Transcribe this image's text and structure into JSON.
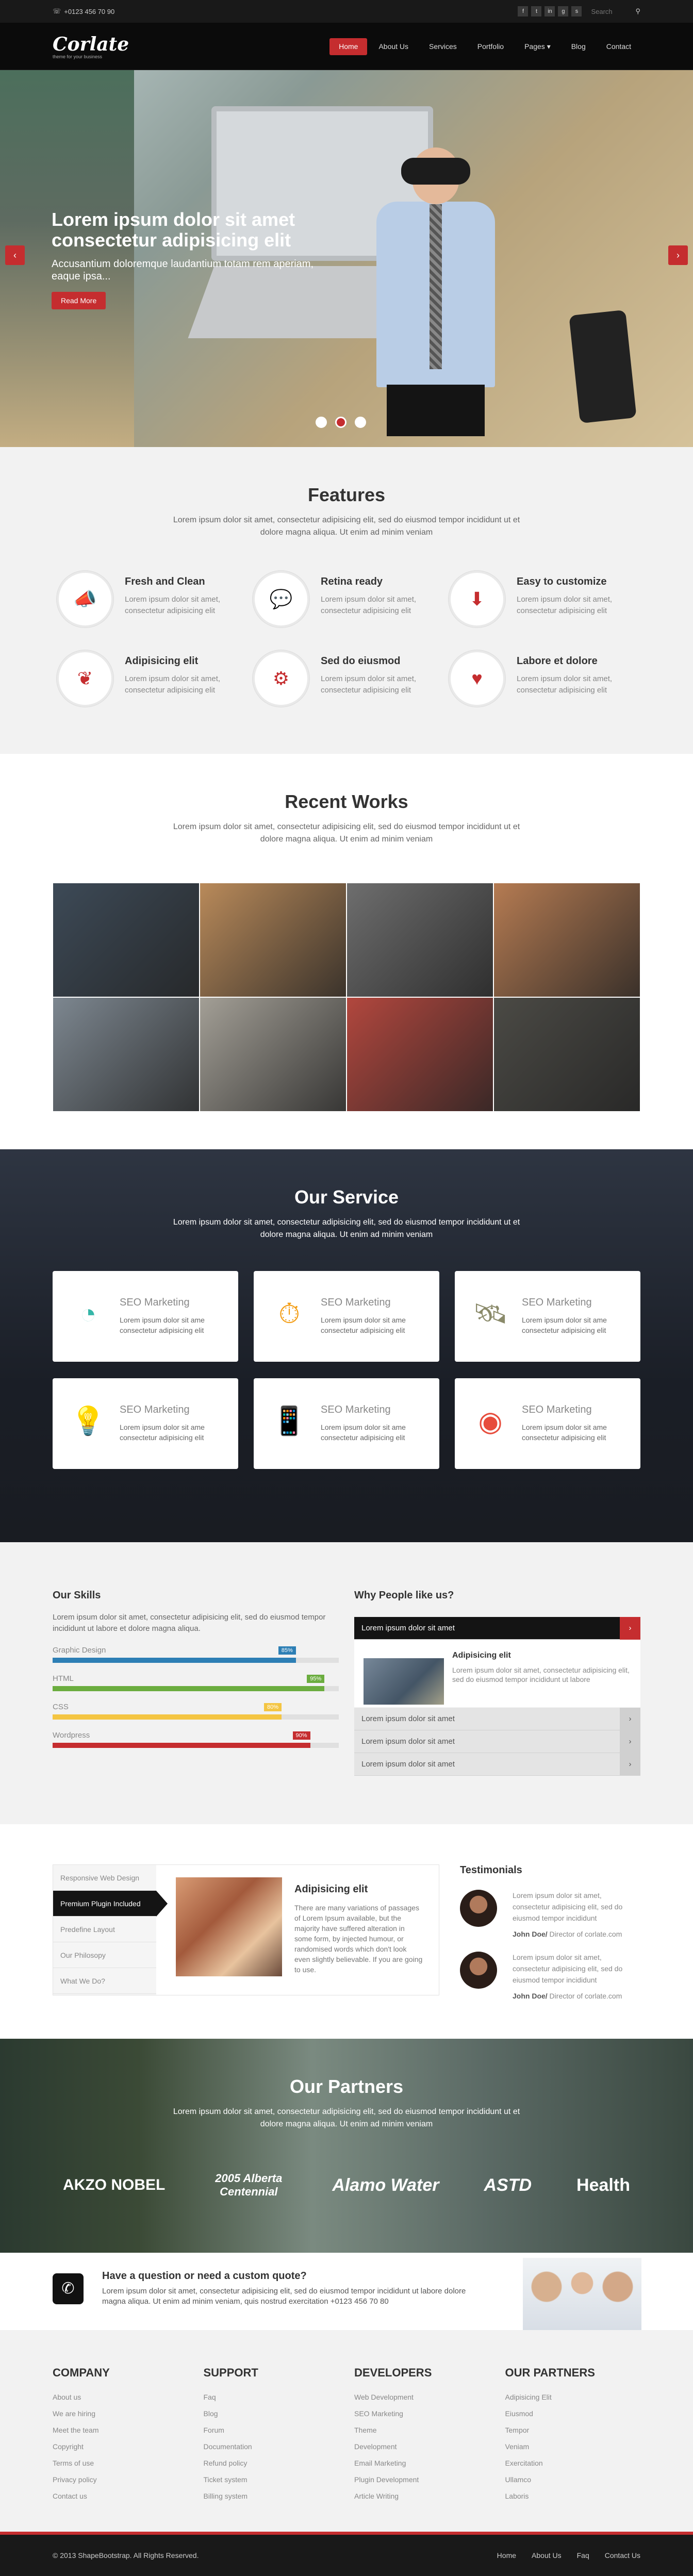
{
  "topbar": {
    "phone": "+0123 456 70 90",
    "search_placeholder": "Search",
    "social": [
      "f",
      "t",
      "in",
      "g",
      "s"
    ]
  },
  "nav": {
    "logo": "Corlate",
    "tagline": "theme for your business",
    "items": [
      "Home",
      "About Us",
      "Services",
      "Portfolio",
      "Pages",
      "Blog",
      "Contact"
    ],
    "active": "Home",
    "dropdown": "Pages"
  },
  "hero": {
    "title": "Lorem ipsum dolor sit amet consectetur adipisicing elit",
    "subtitle": "Accusantium doloremque laudantium totam rem aperiam, eaque ipsa...",
    "button": "Read More",
    "prev": "‹",
    "next": "›",
    "slides": 3,
    "active_slide": 2
  },
  "features": {
    "title": "Features",
    "lead": "Lorem ipsum dolor sit amet, consectetur adipisicing elit, sed do eiusmod tempor incididunt ut et dolore magna aliqua. Ut enim ad minim veniam",
    "items": [
      {
        "icon": "bullhorn-icon",
        "glyph": "📣",
        "title": "Fresh and Clean",
        "text": "Lorem ipsum dolor sit amet, consectetur adipisicing elit"
      },
      {
        "icon": "comments-icon",
        "glyph": "💬",
        "title": "Retina ready",
        "text": "Lorem ipsum dolor sit amet, consectetur adipisicing elit"
      },
      {
        "icon": "download-icon",
        "glyph": "⬇",
        "title": "Easy to customize",
        "text": "Lorem ipsum dolor sit amet, consectetur adipisicing elit"
      },
      {
        "icon": "leaf-icon",
        "glyph": "❦",
        "title": "Adipisicing elit",
        "text": "Lorem ipsum dolor sit amet, consectetur adipisicing elit"
      },
      {
        "icon": "cogs-icon",
        "glyph": "⚙",
        "title": "Sed do eiusmod",
        "text": "Lorem ipsum dolor sit amet, consectetur adipisicing elit"
      },
      {
        "icon": "heart-icon",
        "glyph": "♥",
        "title": "Labore et dolore",
        "text": "Lorem ipsum dolor sit amet, consectetur adipisicing elit"
      }
    ]
  },
  "works": {
    "title": "Recent Works",
    "lead": "Lorem ipsum dolor sit amet, consectetur adipisicing elit, sed do eiusmod tempor incididunt ut et dolore magna aliqua. Ut enim ad minim veniam",
    "tiles": [
      "#3d4a57",
      "#b98a5a",
      "#6e6e6e",
      "#b57b52",
      "#7d8790",
      "#a39f96",
      "#b2473e",
      "#4b4a45"
    ]
  },
  "services": {
    "title": "Our Service",
    "lead": "Lorem ipsum dolor sit amet, consectetur adipisicing elit, sed do eiusmod tempor incididunt ut et dolore magna aliqua. Ut enim ad minim veniam",
    "items": [
      {
        "icon": "pie-chart-icon",
        "glyph": "◔",
        "color": "#35b6a8",
        "title": "SEO Marketing",
        "text": "Lorem ipsum dolor sit ame consectetur adipisicing elit"
      },
      {
        "icon": "stopwatch-icon",
        "glyph": "⏱",
        "color": "#f39c12",
        "title": "SEO Marketing",
        "text": "Lorem ipsum dolor sit ame consectetur adipisicing elit"
      },
      {
        "icon": "satellite-icon",
        "glyph": "🛰",
        "color": "#8a8a6a",
        "title": "SEO Marketing",
        "text": "Lorem ipsum dolor sit ame consectetur adipisicing elit"
      },
      {
        "icon": "lightbulb-icon",
        "glyph": "💡",
        "color": "#f2c94c",
        "title": "SEO Marketing",
        "text": "Lorem ipsum dolor sit ame consectetur adipisicing elit"
      },
      {
        "icon": "tablet-icon",
        "glyph": "📱",
        "color": "#3b7fc4",
        "title": "SEO Marketing",
        "text": "Lorem ipsum dolor sit ame consectetur adipisicing elit"
      },
      {
        "icon": "lifebuoy-icon",
        "glyph": "◉",
        "color": "#e74c3c",
        "title": "SEO Marketing",
        "text": "Lorem ipsum dolor sit ame consectetur adipisicing elit"
      }
    ]
  },
  "skills": {
    "title": "Our Skills",
    "text": "Lorem ipsum dolor sit amet, consectetur adipisicing elit, sed do eiusmod tempor incididunt ut labore et dolore magna aliqua.",
    "items": [
      {
        "name": "Graphic Design",
        "percent": 85,
        "label": "85%",
        "color": "#2d7fb5"
      },
      {
        "name": "HTML",
        "percent": 95,
        "label": "95%",
        "color": "#6bad3f"
      },
      {
        "name": "CSS",
        "percent": 80,
        "label": "80%",
        "color": "#f4c542"
      },
      {
        "name": "Wordpress",
        "percent": 90,
        "label": "90%",
        "color": "#c52d2f"
      }
    ]
  },
  "why": {
    "title": "Why People like us?",
    "open_item": "Lorem ipsum dolor sit amet",
    "open_title": "Adipisicing elit",
    "open_text": "Lorem ipsum dolor sit amet, consectetur adipisicing elit, sed do eiusmod tempor incididunt ut labore",
    "items": [
      "Lorem ipsum dolor sit amet",
      "Lorem ipsum dolor sit amet",
      "Lorem ipsum dolor sit amet"
    ]
  },
  "tabs": {
    "items": [
      "Responsive Web Design",
      "Premium Plugin Included",
      "Predefine Layout",
      "Our Philosopy",
      "What We Do?"
    ],
    "active": 1,
    "title": "Adipisicing elit",
    "text": "There are many variations of passages of Lorem Ipsum available, but the majority have suffered alteration in some form, by injected humour, or randomised words which don't look even slightly believable. If you are going to use."
  },
  "testimonials": {
    "title": "Testimonials",
    "items": [
      {
        "text": "Lorem ipsum dolor sit amet, consectetur adipisicing elit, sed do eiusmod tempor incididunt",
        "name": "John Doe/",
        "role": " Director of corlate.com"
      },
      {
        "text": "Lorem ipsum dolor sit amet, consectetur adipisicing elit, sed do eiusmod tempor incididunt",
        "name": "John Doe/",
        "role": " Director of corlate.com"
      }
    ]
  },
  "partners": {
    "title": "Our Partners",
    "lead": "Lorem ipsum dolor sit amet, consectetur adipisicing elit, sed do eiusmod tempor incididunt ut et dolore magna aliqua. Ut enim ad minim veniam",
    "logos": [
      "AKZO NOBEL",
      "2005 Alberta Centennial",
      "Alamo Water",
      "ASTD",
      "Health"
    ]
  },
  "quote": {
    "title": "Have a question or need a custom quote?",
    "text": "Lorem ipsum dolor sit amet, consectetur adipisicing elit, sed do eiusmod tempor incididunt ut labore dolore magna aliqua. Ut enim ad minim veniam, quis nostrud exercitation +0123 456 70 80"
  },
  "footer": {
    "columns": [
      {
        "title": "COMPANY",
        "links": [
          "About us",
          "We are hiring",
          "Meet the team",
          "Copyright",
          "Terms of use",
          "Privacy policy",
          "Contact us"
        ]
      },
      {
        "title": "SUPPORT",
        "links": [
          "Faq",
          "Blog",
          "Forum",
          "Documentation",
          "Refund policy",
          "Ticket system",
          "Billing system"
        ]
      },
      {
        "title": "DEVELOPERS",
        "links": [
          "Web Development",
          "SEO Marketing",
          "Theme",
          "Development",
          "Email Marketing",
          "Plugin Development",
          "Article Writing"
        ]
      },
      {
        "title": "OUR PARTNERS",
        "links": [
          "Adipisicing Elit",
          "Eiusmod",
          "Tempor",
          "Veniam",
          "Exercitation",
          "Ullamco",
          "Laboris"
        ]
      }
    ],
    "copyright": "© 2013 ShapeBootstrap. All Rights Reserved.",
    "links": [
      "Home",
      "About Us",
      "Faq",
      "Contact Us"
    ]
  },
  "colors": {
    "accent": "#c52d2f",
    "dark": "#191919"
  }
}
